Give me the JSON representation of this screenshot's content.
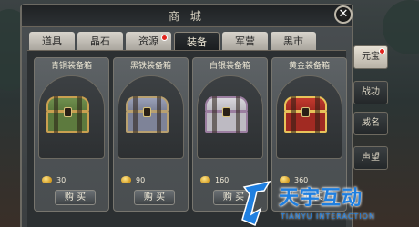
{
  "window": {
    "title": "商 城"
  },
  "tabs": [
    {
      "label": "道具",
      "active": false,
      "badge": false
    },
    {
      "label": "晶石",
      "active": false,
      "badge": false
    },
    {
      "label": "资源",
      "active": false,
      "badge": true
    },
    {
      "label": "装备",
      "active": true,
      "badge": false
    },
    {
      "label": "军营",
      "active": false,
      "badge": false
    },
    {
      "label": "黑市",
      "active": false,
      "badge": false
    }
  ],
  "items": [
    {
      "name": "青铜装备箱",
      "price": "30",
      "buy_label": "购 买",
      "lid": "#6f8f4e",
      "box": "#5d7a3e",
      "trim": "#c9a050"
    },
    {
      "name": "黑铁装备箱",
      "price": "90",
      "buy_label": "购 买",
      "lid": "#9aa0b8",
      "box": "#7e8398",
      "trim": "#b8a070"
    },
    {
      "name": "白银装备箱",
      "price": "160",
      "buy_label": "购 买",
      "lid": "#d8d6dc",
      "box": "#bdbac2",
      "trim": "#9b7ea0"
    },
    {
      "name": "黄金装备箱",
      "price": "360",
      "buy_label": "购 买",
      "lid": "#c23a2e",
      "box": "#a12a22",
      "trim": "#e8c35a"
    }
  ],
  "side_nav": [
    {
      "label": "元宝",
      "active": true,
      "badge": true
    },
    {
      "label": "战功",
      "active": false,
      "badge": false
    },
    {
      "label": "威名",
      "active": false,
      "badge": false
    },
    {
      "label": "声望",
      "active": false,
      "badge": false
    }
  ],
  "watermark": {
    "main": "天宇互动",
    "sub": "TIANYU INTERACTION"
  },
  "colors": {
    "badge": "#e2241d",
    "gold": "#e8b53a",
    "watermark": "#1f7fe0"
  }
}
